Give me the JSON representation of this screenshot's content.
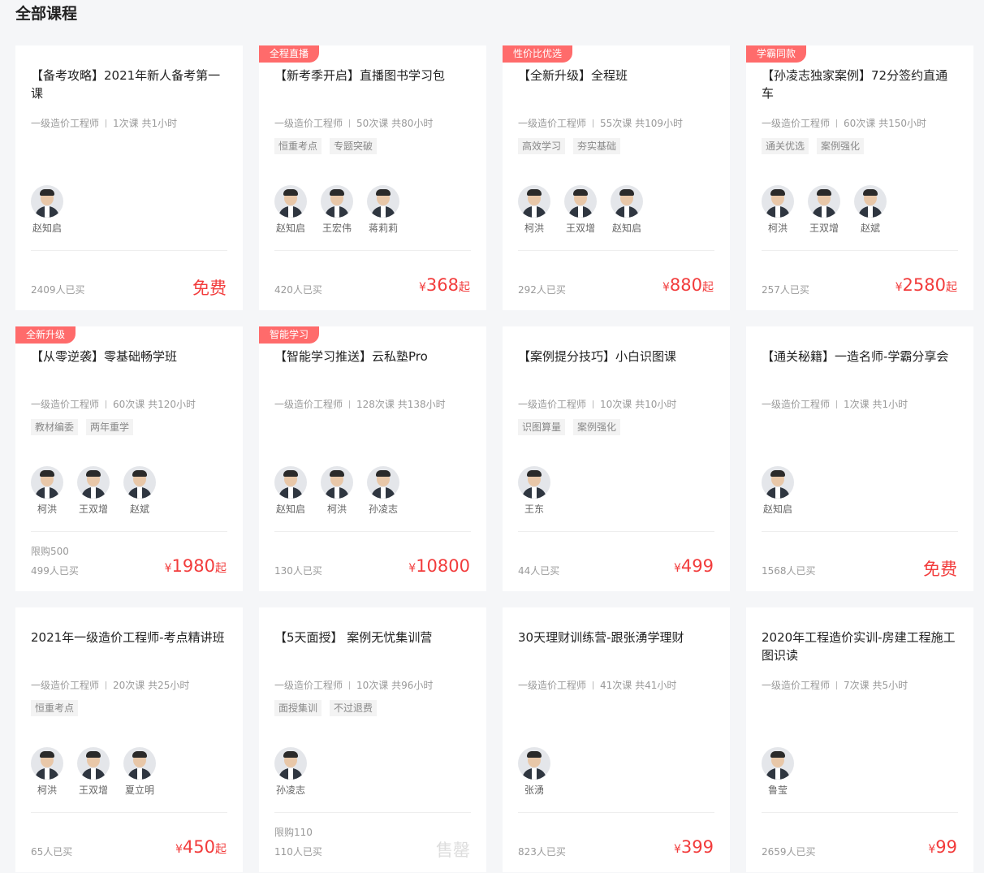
{
  "page_title": "全部课程",
  "courses": [
    {
      "badge": "",
      "title": "【备考攻略】2021年新人备考第一课",
      "category": "一级造价工程师",
      "lessons": "1次课 共1小时",
      "tags": [],
      "teachers": [
        "赵知启"
      ],
      "limit": "",
      "bought": "2409人已买",
      "price": {
        "type": "free",
        "text": "免费"
      }
    },
    {
      "badge": "全程直播",
      "title": "【新考季开启】直播图书学习包",
      "category": "一级造价工程师",
      "lessons": "50次课 共80小时",
      "tags": [
        "恒重考点",
        "专题突破"
      ],
      "teachers": [
        "赵知启",
        "王宏伟",
        "蒋莉莉"
      ],
      "limit": "",
      "bought": "420人已买",
      "price": {
        "type": "paid",
        "currency": "¥",
        "amount": "368",
        "suffix": "起"
      }
    },
    {
      "badge": "性价比优选",
      "title": "【全新升级】全程班",
      "category": "一级造价工程师",
      "lessons": "55次课 共109小时",
      "tags": [
        "高效学习",
        "夯实基础"
      ],
      "teachers": [
        "柯洪",
        "王双增",
        "赵知启"
      ],
      "limit": "",
      "bought": "292人已买",
      "price": {
        "type": "paid",
        "currency": "¥",
        "amount": "880",
        "suffix": "起"
      }
    },
    {
      "badge": "学霸同款",
      "title": "【孙凌志独家案例】72分签约直通车",
      "category": "一级造价工程师",
      "lessons": "60次课 共150小时",
      "tags": [
        "通关优选",
        "案例强化"
      ],
      "teachers": [
        "柯洪",
        "王双增",
        "赵斌"
      ],
      "limit": "",
      "bought": "257人已买",
      "price": {
        "type": "paid",
        "currency": "¥",
        "amount": "2580",
        "suffix": "起"
      }
    },
    {
      "badge": "全新升级",
      "title": "【从零逆袭】零基础畅学班",
      "category": "一级造价工程师",
      "lessons": "60次课 共120小时",
      "tags": [
        "教材编委",
        "两年重学"
      ],
      "teachers": [
        "柯洪",
        "王双增",
        "赵斌"
      ],
      "limit": "限购500",
      "bought": "499人已买",
      "price": {
        "type": "paid",
        "currency": "¥",
        "amount": "1980",
        "suffix": "起"
      }
    },
    {
      "badge": "智能学习",
      "title": "【智能学习推送】云私塾Pro",
      "category": "一级造价工程师",
      "lessons": "128次课 共138小时",
      "tags": [],
      "teachers": [
        "赵知启",
        "柯洪",
        "孙凌志"
      ],
      "limit": "",
      "bought": "130人已买",
      "price": {
        "type": "paid",
        "currency": "¥",
        "amount": "10800",
        "suffix": ""
      }
    },
    {
      "badge": "",
      "title": "【案例提分技巧】小白识图课",
      "category": "一级造价工程师",
      "lessons": "10次课 共10小时",
      "tags": [
        "识图算量",
        "案例强化"
      ],
      "teachers": [
        "王东"
      ],
      "limit": "",
      "bought": "44人已买",
      "price": {
        "type": "paid",
        "currency": "¥",
        "amount": "499",
        "suffix": ""
      }
    },
    {
      "badge": "",
      "title": "【通关秘籍】一造名师-学霸分享会",
      "category": "一级造价工程师",
      "lessons": "1次课 共1小时",
      "tags": [],
      "teachers": [
        "赵知启"
      ],
      "limit": "",
      "bought": "1568人已买",
      "price": {
        "type": "free",
        "text": "免费"
      }
    },
    {
      "badge": "",
      "title": "2021年一级造价工程师-考点精讲班",
      "category": "一级造价工程师",
      "lessons": "20次课 共25小时",
      "tags": [
        "恒重考点"
      ],
      "teachers": [
        "柯洪",
        "王双增",
        "夏立明"
      ],
      "limit": "",
      "bought": "65人已买",
      "price": {
        "type": "paid",
        "currency": "¥",
        "amount": "450",
        "suffix": "起"
      }
    },
    {
      "badge": "",
      "title": "【5天面授】 案例无忧集训营",
      "category": "一级造价工程师",
      "lessons": "10次课 共96小时",
      "tags": [
        "面授集训",
        "不过退费"
      ],
      "teachers": [
        "孙凌志"
      ],
      "limit": "限购110",
      "bought": "110人已买",
      "price": {
        "type": "soldout",
        "text": "售罄"
      }
    },
    {
      "badge": "",
      "title": "30天理财训练营-跟张湧学理财",
      "category": "一级造价工程师",
      "lessons": "41次课 共41小时",
      "tags": [],
      "teachers": [
        "张湧"
      ],
      "limit": "",
      "bought": "823人已买",
      "price": {
        "type": "paid",
        "currency": "¥",
        "amount": "399",
        "suffix": ""
      }
    },
    {
      "badge": "",
      "title": "2020年工程造价实训-房建工程施工图识读",
      "category": "一级造价工程师",
      "lessons": "7次课 共5小时",
      "tags": [],
      "teachers": [
        "鲁莹"
      ],
      "limit": "",
      "bought": "2659人已买",
      "price": {
        "type": "paid",
        "currency": "¥",
        "amount": "99",
        "suffix": ""
      }
    }
  ],
  "colors": {
    "accent": "#f23c3c",
    "badge": "#ff6b6b",
    "background": "#f5f6f8"
  }
}
